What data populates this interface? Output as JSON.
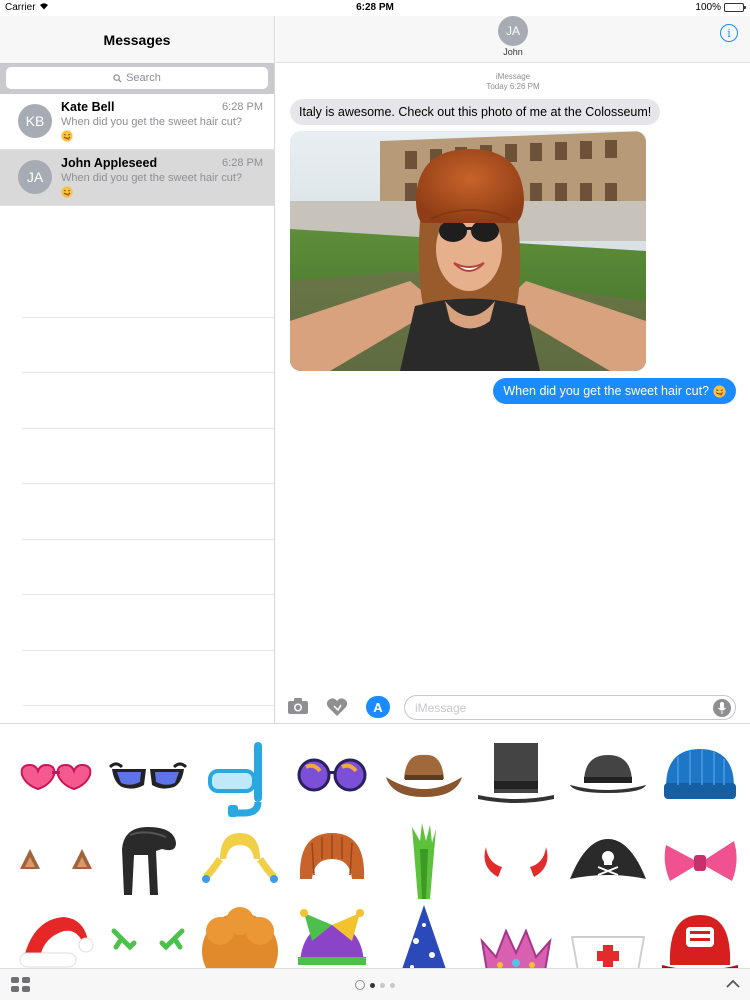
{
  "status_bar": {
    "carrier": "Carrier",
    "time": "6:28 PM",
    "battery": "100%"
  },
  "sidebar": {
    "title": "Messages",
    "search_placeholder": "Search",
    "conversations": [
      {
        "initials": "KB",
        "name": "Kate Bell",
        "time": "6:28 PM",
        "preview": "When did you get the sweet hair cut?",
        "emoji": "face-tongue-wink-icon"
      },
      {
        "initials": "JA",
        "name": "John Appleseed",
        "time": "6:28 PM",
        "preview": "When did you get the sweet hair cut?",
        "emoji": "face-tongue-wink-icon",
        "selected": true
      }
    ]
  },
  "conversation": {
    "contact_initials": "JA",
    "contact_name": "John",
    "service": "iMessage",
    "timestamp": "Today 6:26 PM",
    "messages": [
      {
        "direction": "incoming",
        "text": "Italy is awesome. Check out this photo of me at the Colosseum!"
      },
      {
        "direction": "incoming",
        "type": "photo"
      },
      {
        "direction": "outgoing",
        "text": "When did you get the sweet hair cut?",
        "emoji": "face-tongue-wink-icon"
      }
    ],
    "input_placeholder": "iMessage"
  },
  "stickers": [
    "heart-sunglasses",
    "blue-lens-sunglasses",
    "snorkel-mask",
    "round-goggles",
    "cowboy-hat",
    "top-hat",
    "bowler-hat",
    "blue-beanie",
    "cat-ears",
    "black-pompadour-wig",
    "blonde-braids-wig",
    "orange-bowl-wig",
    "green-mohawk",
    "red-devil-horns",
    "pirate-hat",
    "pink-bow-tie",
    "santa-hat",
    "green-antlers",
    "orange-afro-wig",
    "jester-hat",
    "wizard-hat",
    "pink-crown",
    "nurse-cap",
    "fire-chief-helmet"
  ],
  "colors": {
    "accent": "#1a8cff",
    "bubble_in": "#e6e6ea",
    "selected_row": "#d9d9d9"
  }
}
